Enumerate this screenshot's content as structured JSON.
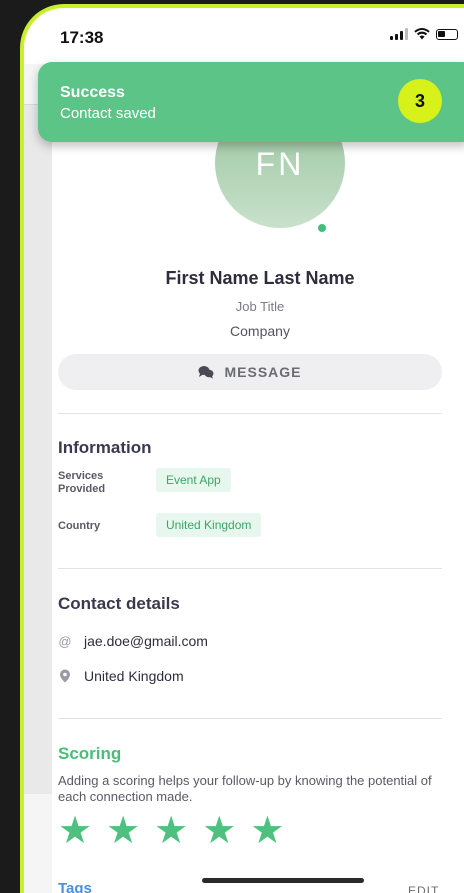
{
  "status_bar": {
    "time": "17:38"
  },
  "toast": {
    "title": "Success",
    "message": "Contact saved",
    "count": "3"
  },
  "profile": {
    "initials": "FN",
    "name": "First Name Last Name",
    "job_title": "Job Title",
    "company": "Company"
  },
  "message_button": {
    "label": "MESSAGE"
  },
  "information": {
    "title": "Information",
    "rows": [
      {
        "label": "Services Provided",
        "value": "Event App"
      },
      {
        "label": "Country",
        "value": "United Kingdom"
      }
    ]
  },
  "contact_details": {
    "title": "Contact details",
    "email": "jae.doe@gmail.com",
    "location": "United Kingdom"
  },
  "scoring": {
    "title": "Scoring",
    "description": "Adding a scoring helps your follow-up by knowing the potential of each connection made.",
    "stars_filled": 5
  },
  "tags": {
    "title": "Tags",
    "edit_label": "EDIT"
  },
  "colors": {
    "accent_green": "#5dc487",
    "frame": "#c8f02a",
    "badge": "#d6f21a",
    "tags_blue": "#4a8fe0"
  }
}
